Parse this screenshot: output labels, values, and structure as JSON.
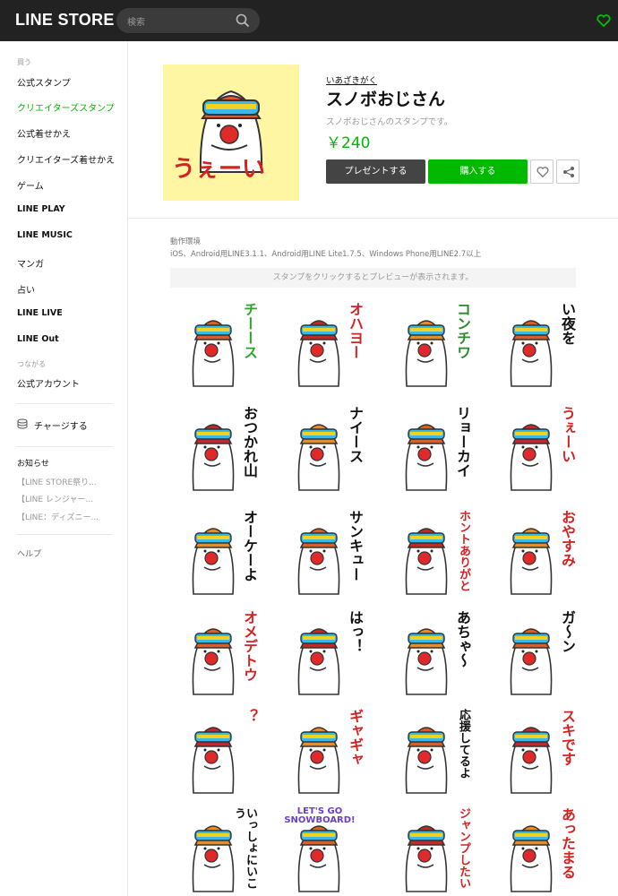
{
  "header": {
    "logo": "LINE STORE",
    "search_placeholder": "検索"
  },
  "sidebar": {
    "buy_caption": "買う",
    "items": [
      {
        "label": "公式スタンプ",
        "active": false
      },
      {
        "label": "クリエイターズスタンプ",
        "active": true
      },
      {
        "label": "公式着せかえ",
        "active": false
      },
      {
        "label": "クリエイターズ着せかえ",
        "active": false
      },
      {
        "label": "ゲーム",
        "active": false
      },
      {
        "label": "LINE PLAY",
        "active": false
      },
      {
        "label": "LINE MUSIC",
        "active": false
      },
      {
        "label": "マンガ",
        "active": false
      },
      {
        "label": "占い",
        "active": false
      },
      {
        "label": "LINE LIVE",
        "active": false
      },
      {
        "label": "LINE Out",
        "active": false
      }
    ],
    "connect_caption": "つながる",
    "official_account": "公式アカウント",
    "charge": "チャージする",
    "news_caption": "お知らせ",
    "news": [
      "【LINE STORE祭り...",
      "【LINE レンジャー...",
      "【LINE：ディズニー..."
    ],
    "help": "ヘルプ"
  },
  "product": {
    "creator": "いあざきがく",
    "title": "スノボおじさん",
    "description": "スノボおじさんのスタンプです。",
    "price": "￥240",
    "gift_button": "プレゼントする",
    "buy_button": "購入する",
    "thumb_text": "うぇーい"
  },
  "environment": {
    "caption": "動作環境",
    "text": "iOS、Android用LINE3.1.1、Android用LINE Lite1.7.5、Windows Phone用LINE2.7以上"
  },
  "preview_hint": "スタンプをクリックするとプレビューが表示されます。",
  "stickers": [
    {
      "text": "チーース",
      "color": "#2aa52a"
    },
    {
      "text": "オハヨー",
      "color": "#d42222"
    },
    {
      "text": "コンチワ",
      "color": "#2a8a2a"
    },
    {
      "text": "い夜を",
      "color": "#111111"
    },
    {
      "text": "おつかれ山",
      "color": "#111111"
    },
    {
      "text": "ナイース",
      "color": "#111111"
    },
    {
      "text": "リョーカイ",
      "color": "#111111"
    },
    {
      "text": "うぇーい",
      "color": "#d42222"
    },
    {
      "text": "オーケーよ",
      "color": "#111111"
    },
    {
      "text": "サンキュー",
      "color": "#111111"
    },
    {
      "text": "ホントありがと",
      "color": "#d42222"
    },
    {
      "text": "おやすみ",
      "color": "#d42222"
    },
    {
      "text": "オメデトウ",
      "color": "#d42222"
    },
    {
      "text": "はっ！",
      "color": "#111111"
    },
    {
      "text": "あちゃ〜",
      "color": "#111111"
    },
    {
      "text": "ガ〜ン",
      "color": "#111111"
    },
    {
      "text": "？",
      "color": "#d42222"
    },
    {
      "text": "ギャギャ",
      "color": "#d42222"
    },
    {
      "text": "応援してるよ",
      "color": "#111111"
    },
    {
      "text": "スキです",
      "color": "#d42222"
    },
    {
      "text": "いっしょにいこう",
      "color": "#111111"
    },
    {
      "text": "LET'S GO SNOWBOARD!",
      "color": "#6a3fc9"
    },
    {
      "text": "ジャンプしたい",
      "color": "#d42222"
    },
    {
      "text": "あったまる",
      "color": "#d42222"
    }
  ]
}
